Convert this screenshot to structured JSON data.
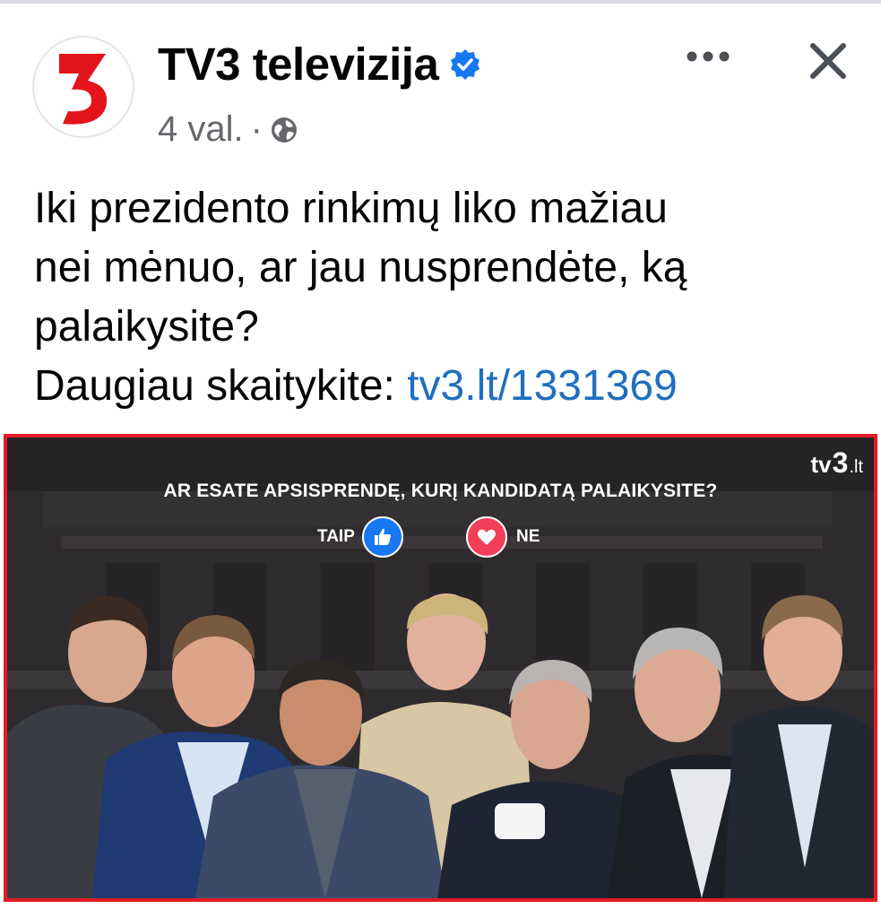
{
  "post": {
    "page_name": "TV3 televizija",
    "time": "4 val.",
    "separator": "·",
    "text_lines": [
      "Iki prezidento rinkimų liko mažiau",
      "nei mėnuo, ar jau nusprendėte, ką",
      "palaikysite?"
    ],
    "read_more_prefix": "Daugiau skaitykite: ",
    "link_text": "tv3.lt/1331369",
    "icons": {
      "avatar": "tv3-logo-icon",
      "verified": "verified-badge-icon",
      "audience": "globe-icon",
      "more": "more-options-icon",
      "close": "close-icon"
    }
  },
  "image": {
    "watermark_prefix": "tv",
    "watermark_three": "3",
    "watermark_suffix": ".lt",
    "poll_question": "AR ESATE APSISPRENDĘ, KURĮ KANDIDATĄ PALAIKYSITE?",
    "option_yes": "TAIP",
    "option_no": "NE",
    "border_color": "#e31b23"
  },
  "colors": {
    "link": "#1f6fc0",
    "secondary_text": "#65676b",
    "verified": "#1877f2",
    "logo_red": "#e3141c"
  }
}
